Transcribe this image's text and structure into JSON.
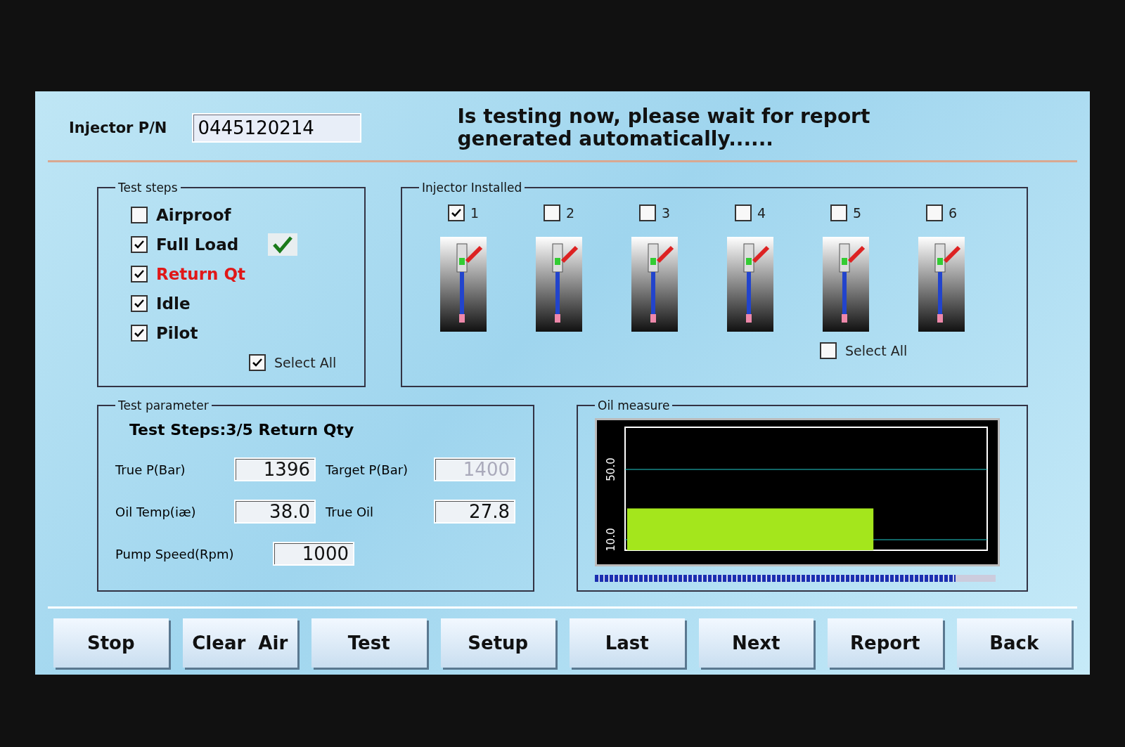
{
  "header": {
    "pn_label": "Injector P/N",
    "pn_value": "0445120214",
    "message": "Is testing now, please wait for report generated automatically......"
  },
  "test_steps": {
    "title": "Test steps",
    "items": [
      {
        "label": "Airproof",
        "checked": false,
        "active": false,
        "passed": false
      },
      {
        "label": "Full Load",
        "checked": true,
        "active": false,
        "passed": true
      },
      {
        "label": "Return Qt",
        "checked": true,
        "active": true,
        "passed": false
      },
      {
        "label": "Idle",
        "checked": true,
        "active": false,
        "passed": false
      },
      {
        "label": "Pilot",
        "checked": true,
        "active": false,
        "passed": false
      }
    ],
    "select_all": {
      "label": "Select All",
      "checked": true
    }
  },
  "injectors": {
    "title": "Injector Installed",
    "items": [
      {
        "label": "1",
        "checked": true
      },
      {
        "label": "2",
        "checked": false
      },
      {
        "label": "3",
        "checked": false
      },
      {
        "label": "4",
        "checked": false
      },
      {
        "label": "5",
        "checked": false
      },
      {
        "label": "6",
        "checked": false
      }
    ],
    "select_all": {
      "label": "Select All",
      "checked": false
    }
  },
  "test_parameter": {
    "title": "Test parameter",
    "heading": "Test Steps:3/5 Return Qty",
    "rows": [
      [
        {
          "label": "True P(Bar)",
          "value": "1396",
          "disabled": false
        },
        {
          "label": "Target P(Bar)",
          "value": "1400",
          "disabled": true
        }
      ],
      [
        {
          "label": "Oil Temp(iæ)",
          "value": "38.0",
          "disabled": false
        },
        {
          "label": "True Oil",
          "value": "27.8",
          "disabled": false
        }
      ],
      [
        {
          "label": "Pump Speed(Rpm)",
          "value": "1000",
          "disabled": false
        }
      ]
    ]
  },
  "oil_measure": {
    "title": "Oil measure",
    "chart_data": {
      "type": "bar",
      "categories": [
        null
      ],
      "values": [
        27.8
      ],
      "ylim": [
        4,
        74
      ],
      "yticks": [
        {
          "value": 10,
          "label": "10.0"
        },
        {
          "value": 50,
          "label": "50.0"
        }
      ]
    },
    "progress": {
      "level": 0.9
    }
  },
  "buttons": [
    "Stop",
    "Clear  Air",
    "Test",
    "Setup",
    "Last",
    "Next",
    "Report",
    "Back"
  ]
}
